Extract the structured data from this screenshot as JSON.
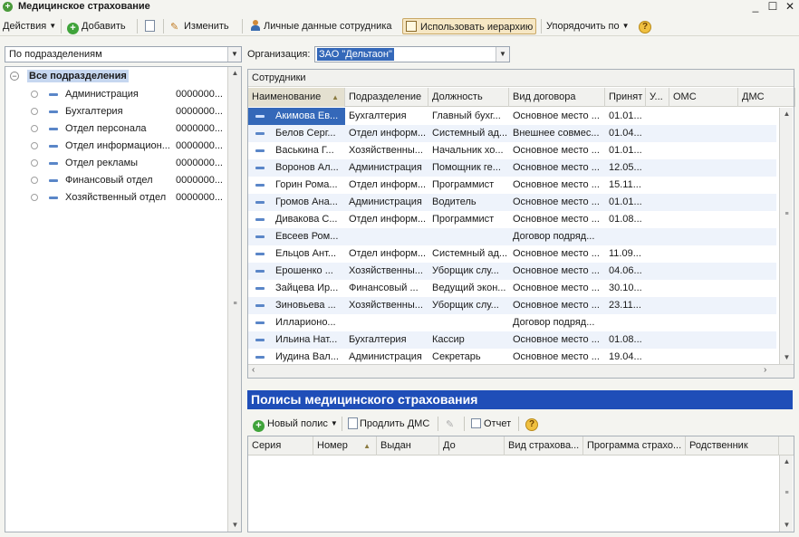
{
  "window": {
    "title": "Медицинское страхование"
  },
  "toolbar": {
    "actions": "Действия",
    "add": "Добавить",
    "edit": "Изменить",
    "personal": "Личные данные сотрудника",
    "hierarchy": "Использовать иерархию",
    "sort": "Упорядочить по"
  },
  "filter": {
    "grouping": "По подразделениям"
  },
  "org": {
    "label": "Организация:",
    "value": "ЗАО \"Дельтаон\""
  },
  "tree": {
    "root": "Все подразделения",
    "items": [
      {
        "name": "Администрация",
        "code": "0000000..."
      },
      {
        "name": "Бухгалтерия",
        "code": "0000000..."
      },
      {
        "name": "Отдел персонала",
        "code": "0000000..."
      },
      {
        "name": "Отдел информацион...",
        "code": "0000000..."
      },
      {
        "name": "Отдел рекламы",
        "code": "0000000..."
      },
      {
        "name": "Финансовый отдел",
        "code": "0000000..."
      },
      {
        "name": "Хозяйственный отдел",
        "code": "0000000..."
      }
    ]
  },
  "employees": {
    "caption": "Сотрудники",
    "columns": [
      "Наименование",
      "Подразделение",
      "Должность",
      "Вид договора",
      "Принят",
      "У...",
      "ОМС",
      "ДМС"
    ],
    "rows": [
      [
        "Акимова Ев...",
        "Бухгалтерия",
        "Главный бухг...",
        "Основное место ...",
        "01.01..."
      ],
      [
        "Белов Серг...",
        "Отдел информ...",
        "Системный ад...",
        "Внешнее совмес...",
        "01.04..."
      ],
      [
        "Васькина Г...",
        "Хозяйственны...",
        "Начальник хо...",
        "Основное место ...",
        "01.01..."
      ],
      [
        "Воронов Ал...",
        "Администрация",
        "Помощник ге...",
        "Основное место ...",
        "12.05..."
      ],
      [
        "Горин Рома...",
        "Отдел информ...",
        "Программист",
        "Основное место ...",
        "15.11..."
      ],
      [
        "Громов Ана...",
        "Администрация",
        "Водитель",
        "Основное место ...",
        "01.01..."
      ],
      [
        "Дивакова С...",
        "Отдел информ...",
        "Программист",
        "Основное место ...",
        "01.08..."
      ],
      [
        "Евсеев Ром...",
        "",
        "",
        "Договор подряд...",
        ""
      ],
      [
        "Ельцов Ант...",
        "Отдел информ...",
        "Системный ад...",
        "Основное место ...",
        "11.09..."
      ],
      [
        "Ерошенко ...",
        "Хозяйственны...",
        "Уборщик слу...",
        "Основное место ...",
        "04.06..."
      ],
      [
        "Зайцева Ир...",
        "Финансовый ...",
        "Ведущий экон...",
        "Основное место ...",
        "30.10..."
      ],
      [
        "Зиновьева ...",
        "Хозяйственны...",
        "Уборщик слу...",
        "Основное место ...",
        "23.11..."
      ],
      [
        "Илларионо...",
        "",
        "",
        "Договор подряд...",
        ""
      ],
      [
        "Ильина Нат...",
        "Бухгалтерия",
        "Кассир",
        "Основное место ...",
        "01.08..."
      ],
      [
        "Иудина Вал...",
        "Администрация",
        "Секретарь",
        "Основное место ...",
        "19.04..."
      ]
    ]
  },
  "policies": {
    "title": "Полисы медицинского страхования",
    "toolbar": {
      "new": "Новый полис",
      "extend": "Продлить ДМС",
      "report": "Отчет"
    },
    "columns": [
      "Серия",
      "Номер",
      "Выдан",
      "До",
      "Вид страхова...",
      "Программа страхо...",
      "Родственник"
    ]
  }
}
